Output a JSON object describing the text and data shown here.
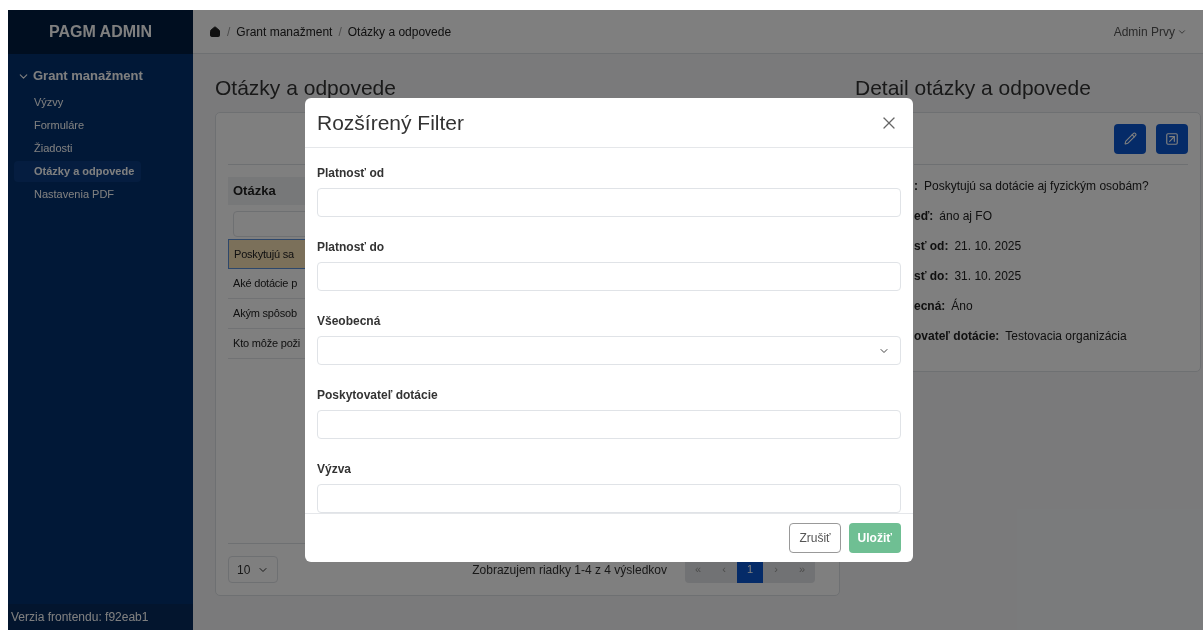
{
  "sidebar": {
    "brand": "PAGM ADMIN",
    "groups": [
      {
        "label": "Grant manažment",
        "expanded": true,
        "items": [
          {
            "label": "Výzvy",
            "selected": false
          },
          {
            "label": "Formuláre",
            "selected": false
          },
          {
            "label": "Žiadosti",
            "selected": false
          },
          {
            "label": "Otázky a odpovede",
            "selected": true
          },
          {
            "label": "Nastavenia PDF",
            "selected": false
          }
        ]
      }
    ],
    "footer": "Verzia frontendu: f92eab1"
  },
  "header": {
    "breadcrumb": [
      "/",
      "Grant manažment",
      "/",
      "Otázky a odpovede"
    ],
    "user": "Admin Prvy"
  },
  "list": {
    "title": "Otázky a odpovede",
    "columns": [
      "Otázka"
    ],
    "rows": [
      {
        "cells": [
          "Poskytujú sa"
        ],
        "selected": true
      },
      {
        "cells": [
          "Aké dotácie p"
        ],
        "selected": false
      },
      {
        "cells": [
          "Akým spôsob"
        ],
        "selected": false
      },
      {
        "cells": [
          "Kto môže poži"
        ],
        "selected": false
      }
    ],
    "page_size": "10",
    "summary": "Zobrazujem riadky 1-4 z 4 výsledkov",
    "pagination": [
      {
        "label": "«",
        "selected": false
      },
      {
        "label": "‹",
        "selected": false
      },
      {
        "label": "1",
        "selected": true
      },
      {
        "label": "›",
        "selected": false
      },
      {
        "label": "»",
        "selected": false
      }
    ]
  },
  "detail": {
    "title": "Detail otázky a odpovede",
    "fields": [
      {
        "label": ":",
        "value": "Poskytujú sa dotácie aj fyzickým osobám?"
      },
      {
        "label": "eď:",
        "value": "áno aj FO"
      },
      {
        "label": "sť od:",
        "value": "21. 10. 2025"
      },
      {
        "label": "sť do:",
        "value": "31. 10. 2025"
      },
      {
        "label": "ecná:",
        "value": "Áno"
      },
      {
        "label": "ovateľ dotácie:",
        "value": "Testovacia organizácia"
      }
    ]
  },
  "modal": {
    "title": "Rozšírený Filter",
    "fields": [
      {
        "label": "Platnosť od",
        "kind": "input"
      },
      {
        "label": "Platnosť do",
        "kind": "input"
      },
      {
        "label": "Všeobecná",
        "kind": "select"
      },
      {
        "label": "Poskytovateľ dotácie",
        "kind": "input"
      },
      {
        "label": "Výzva",
        "kind": "input"
      }
    ],
    "buttons": [
      {
        "label": "Zrušiť",
        "kind": "secondary",
        "disabled": false
      },
      {
        "label": "Uložiť",
        "kind": "primary",
        "disabled": true
      }
    ]
  }
}
